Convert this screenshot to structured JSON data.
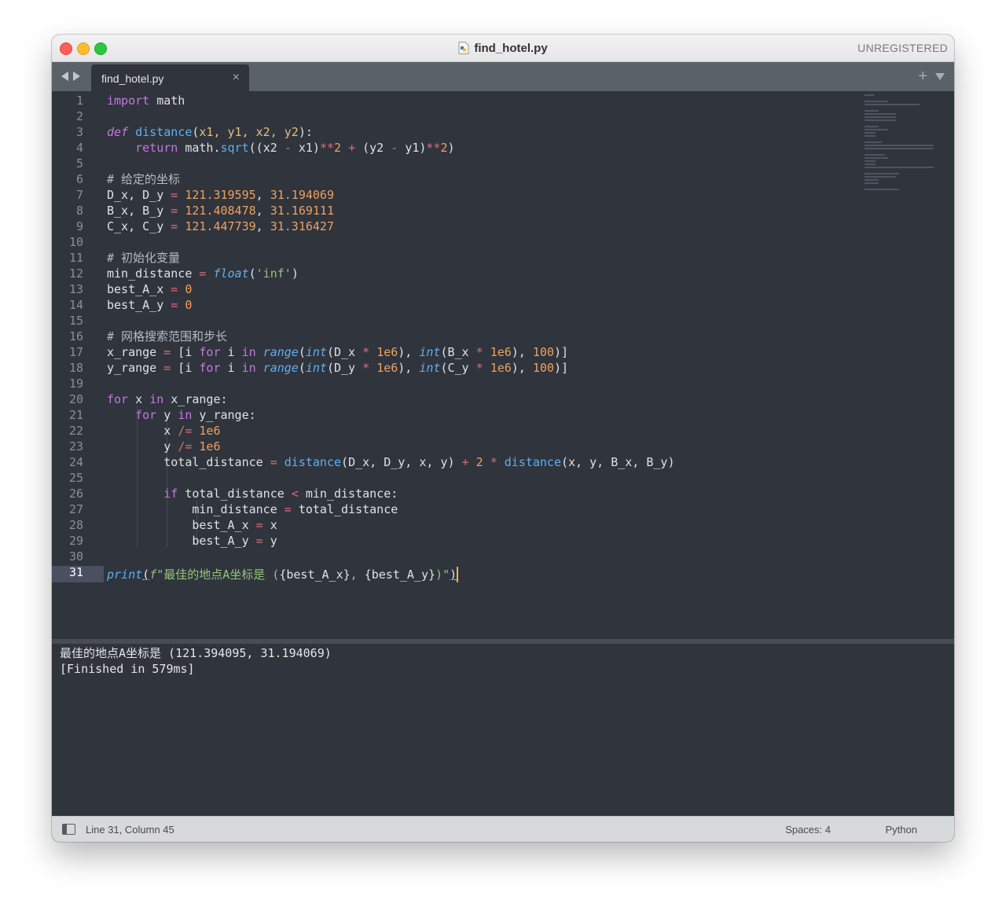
{
  "window": {
    "title": "find_hotel.py",
    "registration": "UNREGISTERED"
  },
  "tabs": [
    {
      "label": "find_hotel.py",
      "close": "×"
    }
  ],
  "tab_actions": {
    "add": "+"
  },
  "editor": {
    "line_numbers": [
      "1",
      "2",
      "3",
      "4",
      "5",
      "6",
      "7",
      "8",
      "9",
      "10",
      "11",
      "12",
      "13",
      "14",
      "15",
      "16",
      "17",
      "18",
      "19",
      "20",
      "21",
      "22",
      "23",
      "24",
      "25",
      "26",
      "27",
      "28",
      "29",
      "30",
      "31"
    ],
    "active_line": "31",
    "code": {
      "l1_kw": "import",
      "l1_rest": " math",
      "l3_def": "def",
      "l3_name": "distance",
      "l3_params": "x1, y1, x2, y2",
      "l4_kw": "return",
      "l4_mod": "math",
      "l4_fn": "sqrt",
      "l4_a": "x2",
      "l4_b": "x1",
      "l4_exp": "2",
      "l4_c": "y2",
      "l4_d": "y1",
      "l4_exp2": "2",
      "l6_comment": "# 给定的坐标",
      "l7_vars": "D_x, D_y",
      "l7_v1": "121.319595",
      "l7_v2": "31.194069",
      "l8_vars": "B_x, B_y",
      "l8_v1": "121.408478",
      "l8_v2": "31.169111",
      "l9_vars": "C_x, C_y",
      "l9_v1": "121.447739",
      "l9_v2": "31.316427",
      "l11_comment": "# 初始化变量",
      "l12_var": "min_distance",
      "l12_fn": "float",
      "l12_str": "'inf'",
      "l13_var": "best_A_x",
      "l13_val": "0",
      "l14_var": "best_A_y",
      "l14_val": "0",
      "l16_comment": "# 网格搜索范围和步长",
      "l17_var": "x_range",
      "l17_a": "D_x",
      "l17_b": "B_x",
      "l18_var": "y_range",
      "l18_a": "D_y",
      "l18_b": "C_y",
      "range_fn": "range",
      "int_fn": "int",
      "for_kw": "for",
      "in_kw": "in",
      "iter_i": "i",
      "sci": "1e6",
      "step": "100",
      "l20_var": "x",
      "l20_iter": "x_range",
      "l21_var": "y",
      "l21_iter": "y_range",
      "l22_var": "x",
      "l23_var": "y",
      "l24_var": "total_distance",
      "l24_fn": "distance",
      "l24_args1": "D_x, D_y, x, y",
      "l24_mul": "2",
      "l24_args2": "x, y, B_x, B_y",
      "l26_kw": "if",
      "l26_a": "total_distance",
      "l26_b": "min_distance",
      "l27_a": "min_distance",
      "l27_b": "total_distance",
      "l28_a": "best_A_x",
      "l28_b": "x",
      "l29_a": "best_A_y",
      "l29_b": "y",
      "l31_fn": "print",
      "l31_prefix": "f",
      "l31_text": "最佳的地点A坐标是 (",
      "l31_e1": "{best_A_x}",
      "l31_sep": ", ",
      "l31_e2": "{best_A_y}",
      "l31_close": ")"
    }
  },
  "output_panel": {
    "lines": [
      "最佳的地点A坐标是 (121.394095, 31.194069)",
      "[Finished in 579ms]"
    ]
  },
  "statusbar": {
    "position": "Line 31, Column 45",
    "indentation": "Spaces: 4",
    "syntax": "Python"
  },
  "colors": {
    "editor_bg": "#2f343d",
    "keyword": "#c678dd",
    "function": "#61afef",
    "number": "#f0a15e",
    "string": "#98c379",
    "operator": "#e06c75",
    "cursor": "#f7b731"
  }
}
